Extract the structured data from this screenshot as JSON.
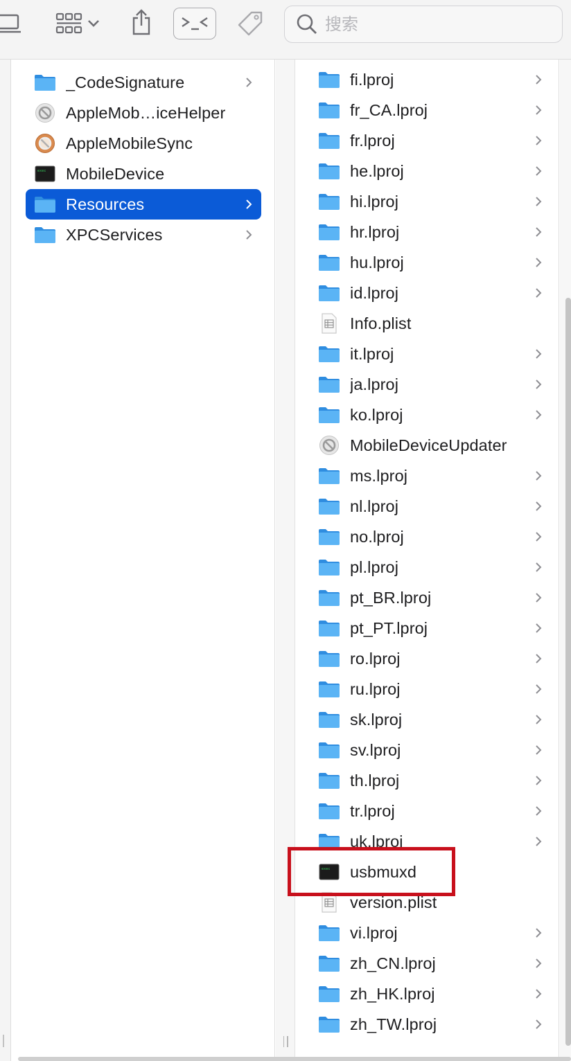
{
  "toolbar": {
    "search_placeholder": "搜索",
    "icons": [
      "sidebar-icon",
      "view-grid-icon",
      "chevron-down-icon",
      "share-icon",
      "terminal-icon",
      "tag-icon",
      "search-icon"
    ]
  },
  "column1": {
    "items": [
      {
        "label": "_CodeSignature",
        "icon": "folder",
        "has_children": true,
        "selected": false
      },
      {
        "label": "AppleMob…iceHelper",
        "icon": "app-disabled",
        "has_children": false,
        "selected": false
      },
      {
        "label": "AppleMobileSync",
        "icon": "app-orange",
        "has_children": false,
        "selected": false
      },
      {
        "label": "MobileDevice",
        "icon": "exec",
        "has_children": false,
        "selected": false
      },
      {
        "label": "Resources",
        "icon": "folder",
        "has_children": true,
        "selected": true
      },
      {
        "label": "XPCServices",
        "icon": "folder",
        "has_children": true,
        "selected": false
      }
    ]
  },
  "column2": {
    "items": [
      {
        "label": "fi.lproj",
        "icon": "folder",
        "has_children": true
      },
      {
        "label": "fr_CA.lproj",
        "icon": "folder",
        "has_children": true
      },
      {
        "label": "fr.lproj",
        "icon": "folder",
        "has_children": true
      },
      {
        "label": "he.lproj",
        "icon": "folder",
        "has_children": true
      },
      {
        "label": "hi.lproj",
        "icon": "folder",
        "has_children": true
      },
      {
        "label": "hr.lproj",
        "icon": "folder",
        "has_children": true
      },
      {
        "label": "hu.lproj",
        "icon": "folder",
        "has_children": true
      },
      {
        "label": "id.lproj",
        "icon": "folder",
        "has_children": true
      },
      {
        "label": "Info.plist",
        "icon": "plist",
        "has_children": false
      },
      {
        "label": "it.lproj",
        "icon": "folder",
        "has_children": true
      },
      {
        "label": "ja.lproj",
        "icon": "folder",
        "has_children": true
      },
      {
        "label": "ko.lproj",
        "icon": "folder",
        "has_children": true
      },
      {
        "label": "MobileDeviceUpdater",
        "icon": "app-disabled",
        "has_children": false
      },
      {
        "label": "ms.lproj",
        "icon": "folder",
        "has_children": true
      },
      {
        "label": "nl.lproj",
        "icon": "folder",
        "has_children": true
      },
      {
        "label": "no.lproj",
        "icon": "folder",
        "has_children": true
      },
      {
        "label": "pl.lproj",
        "icon": "folder",
        "has_children": true
      },
      {
        "label": "pt_BR.lproj",
        "icon": "folder",
        "has_children": true
      },
      {
        "label": "pt_PT.lproj",
        "icon": "folder",
        "has_children": true
      },
      {
        "label": "ro.lproj",
        "icon": "folder",
        "has_children": true
      },
      {
        "label": "ru.lproj",
        "icon": "folder",
        "has_children": true
      },
      {
        "label": "sk.lproj",
        "icon": "folder",
        "has_children": true
      },
      {
        "label": "sv.lproj",
        "icon": "folder",
        "has_children": true
      },
      {
        "label": "th.lproj",
        "icon": "folder",
        "has_children": true
      },
      {
        "label": "tr.lproj",
        "icon": "folder",
        "has_children": true
      },
      {
        "label": "uk.lproj",
        "icon": "folder",
        "has_children": true
      },
      {
        "label": "usbmuxd",
        "icon": "exec",
        "has_children": false,
        "highlighted": true
      },
      {
        "label": "version.plist",
        "icon": "plist",
        "has_children": false
      },
      {
        "label": "vi.lproj",
        "icon": "folder",
        "has_children": true
      },
      {
        "label": "zh_CN.lproj",
        "icon": "folder",
        "has_children": true
      },
      {
        "label": "zh_HK.lproj",
        "icon": "folder",
        "has_children": true
      },
      {
        "label": "zh_TW.lproj",
        "icon": "folder",
        "has_children": true
      }
    ]
  },
  "colors": {
    "selection": "#0b5bd7",
    "highlight_box": "#c8101c",
    "folder": "#3aa0ee"
  }
}
